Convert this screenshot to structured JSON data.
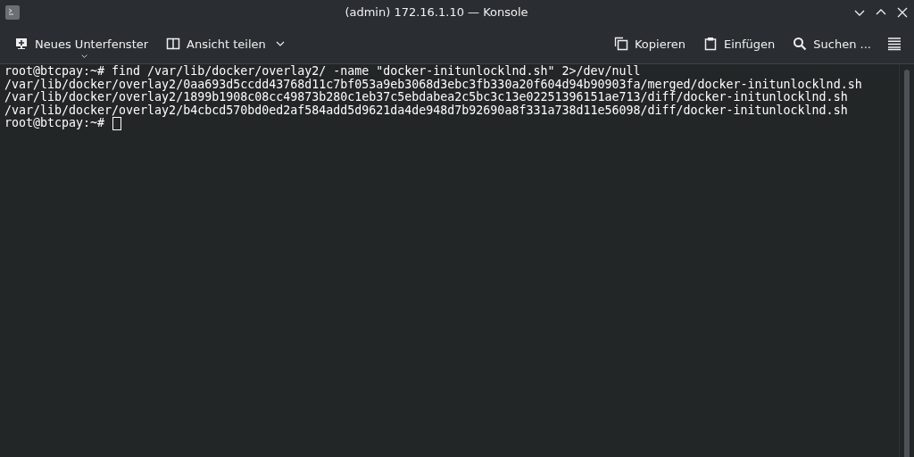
{
  "window": {
    "title": "(admin) 172.16.1.10 — Konsole"
  },
  "toolbar": {
    "left": [
      {
        "kind": "new-tab",
        "label": "Neues Unterfenster"
      },
      {
        "kind": "split",
        "label": "Ansicht teilen"
      }
    ],
    "right": [
      {
        "kind": "copy",
        "label": "Kopieren"
      },
      {
        "kind": "paste",
        "label": "Einfügen"
      },
      {
        "kind": "search",
        "label": "Suchen ..."
      }
    ]
  },
  "terminal": {
    "lines": [
      "root@btcpay:~# find /var/lib/docker/overlay2/ -name \"docker-initunlocklnd.sh\" 2>/dev/null",
      "/var/lib/docker/overlay2/0aa693d5ccdd43768d11c7bf053a9eb3068d3ebc3fb330a20f604d94b90903fa/merged/docker-initunlocklnd.sh",
      "/var/lib/docker/overlay2/1899b1908c08cc49873b280c1eb37c5ebdabea2c5bc3c13e02251396151ae713/diff/docker-initunlocklnd.sh",
      "/var/lib/docker/overlay2/b4cbcd570bd0ed2af584add5d9621da4de948d7b92690a8f331a738d11e56098/diff/docker-initunlocklnd.sh"
    ],
    "prompt": {
      "text": "root@btcpay:~#",
      "cursor": true
    }
  }
}
